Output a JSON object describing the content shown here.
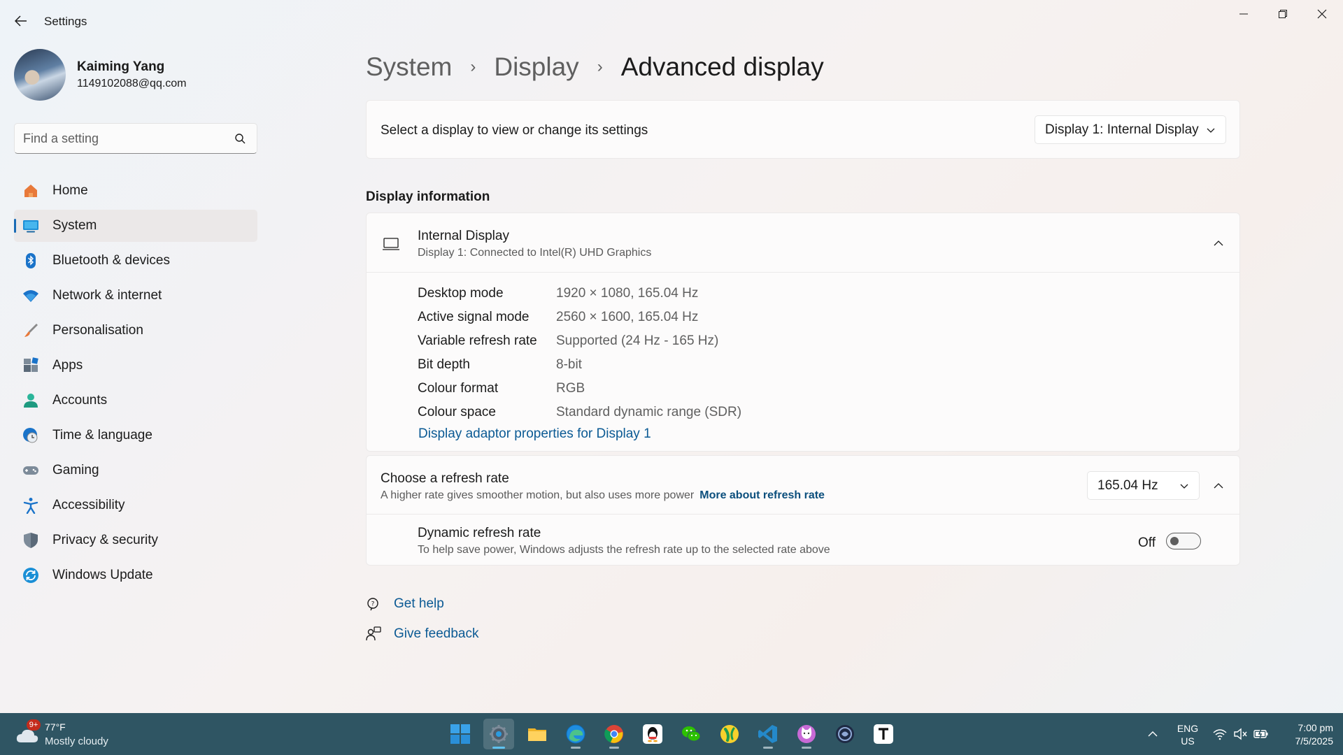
{
  "window": {
    "title": "Settings"
  },
  "profile": {
    "name": "Kaiming Yang",
    "email": "1149102088@qq.com"
  },
  "search": {
    "placeholder": "Find a setting"
  },
  "sidebar": {
    "items": [
      {
        "label": "Home",
        "icon": "home-icon"
      },
      {
        "label": "System",
        "icon": "system-icon",
        "active": true
      },
      {
        "label": "Bluetooth & devices",
        "icon": "bluetooth-icon"
      },
      {
        "label": "Network & internet",
        "icon": "wifi-icon"
      },
      {
        "label": "Personalisation",
        "icon": "brush-icon"
      },
      {
        "label": "Apps",
        "icon": "apps-icon"
      },
      {
        "label": "Accounts",
        "icon": "accounts-icon"
      },
      {
        "label": "Time & language",
        "icon": "clock-globe-icon"
      },
      {
        "label": "Gaming",
        "icon": "gamepad-icon"
      },
      {
        "label": "Accessibility",
        "icon": "accessibility-icon"
      },
      {
        "label": "Privacy & security",
        "icon": "shield-icon"
      },
      {
        "label": "Windows Update",
        "icon": "update-icon"
      }
    ]
  },
  "breadcrumb": {
    "items": [
      "System",
      "Display"
    ],
    "current": "Advanced display"
  },
  "display_select": {
    "label": "Select a display to view or change its settings",
    "value": "Display 1: Internal Display"
  },
  "display_info": {
    "section_title": "Display information",
    "name": "Internal Display",
    "subtitle": "Display 1: Connected to Intel(R) UHD Graphics",
    "rows": [
      {
        "key": "Desktop mode",
        "value": "1920 × 1080, 165.04 Hz"
      },
      {
        "key": "Active signal mode",
        "value": "2560 × 1600, 165.04 Hz"
      },
      {
        "key": "Variable refresh rate",
        "value": "Supported (24 Hz - 165 Hz)"
      },
      {
        "key": "Bit depth",
        "value": "8-bit"
      },
      {
        "key": "Colour format",
        "value": "RGB"
      },
      {
        "key": "Colour space",
        "value": "Standard dynamic range (SDR)"
      }
    ],
    "adapter_link": "Display adaptor properties for Display 1"
  },
  "refresh": {
    "title": "Choose a refresh rate",
    "subtitle": "A higher rate gives smoother motion, but also uses more power",
    "link": "More about refresh rate",
    "value": "165.04 Hz",
    "dynamic_title": "Dynamic refresh rate",
    "dynamic_subtitle": "To help save power, Windows adjusts the refresh rate up to the selected rate above",
    "dynamic_state": "Off",
    "dynamic_on": false
  },
  "help": {
    "get_help": "Get help",
    "give_feedback": "Give feedback"
  },
  "taskbar": {
    "weather_badge": "9+",
    "weather_temp": "77°F",
    "weather_desc": "Mostly cloudy",
    "apps": [
      "start-icon",
      "settings-app-icon",
      "file-explorer-icon",
      "edge-icon",
      "chrome-icon",
      "qq-icon",
      "wechat-icon",
      "app-yellow-icon",
      "vscode-icon",
      "cat-app-icon",
      "circle-app-icon",
      "typora-icon"
    ],
    "lang_line1": "ENG",
    "lang_line2": "US",
    "time": "7:00 pm",
    "date": "7/5/2025"
  },
  "colors": {
    "accent": "#1a6bb5",
    "link": "#0b5a94",
    "taskbar": "#2f5563"
  }
}
